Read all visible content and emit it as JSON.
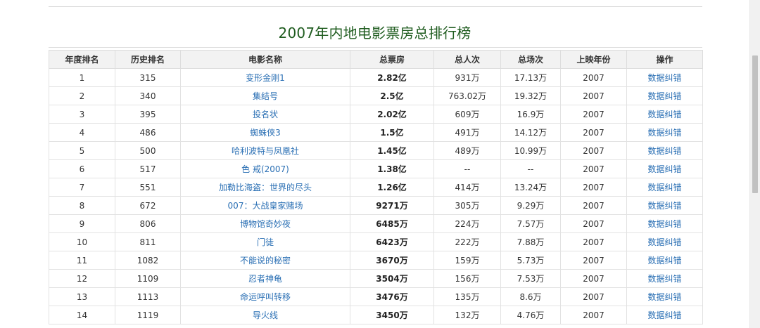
{
  "page": {
    "title": "2007年内地电影票房总排行榜"
  },
  "table": {
    "headers": [
      "年度排名",
      "历史排名",
      "电影名称",
      "总票房",
      "总人次",
      "总场次",
      "上映年份",
      "操作"
    ],
    "rows": [
      {
        "year_rank": "1",
        "hist_rank": "315",
        "title": "变形金刚1",
        "box": "2.82亿",
        "admissions": "931万",
        "screenings": "17.13万",
        "year": "2007",
        "action": "数据纠错"
      },
      {
        "year_rank": "2",
        "hist_rank": "340",
        "title": "集结号",
        "box": "2.5亿",
        "admissions": "763.02万",
        "screenings": "19.32万",
        "year": "2007",
        "action": "数据纠错"
      },
      {
        "year_rank": "3",
        "hist_rank": "395",
        "title": "投名状",
        "box": "2.02亿",
        "admissions": "609万",
        "screenings": "16.9万",
        "year": "2007",
        "action": "数据纠错"
      },
      {
        "year_rank": "4",
        "hist_rank": "486",
        "title": "蜘蛛侠3",
        "box": "1.5亿",
        "admissions": "491万",
        "screenings": "14.12万",
        "year": "2007",
        "action": "数据纠错"
      },
      {
        "year_rank": "5",
        "hist_rank": "500",
        "title": "哈利波特与凤凰社",
        "box": "1.45亿",
        "admissions": "489万",
        "screenings": "10.99万",
        "year": "2007",
        "action": "数据纠错"
      },
      {
        "year_rank": "6",
        "hist_rank": "517",
        "title": "色 戒(2007)",
        "box": "1.38亿",
        "admissions": "--",
        "screenings": "--",
        "year": "2007",
        "action": "数据纠错"
      },
      {
        "year_rank": "7",
        "hist_rank": "551",
        "title": "加勒比海盗：世界的尽头",
        "box": "1.26亿",
        "admissions": "414万",
        "screenings": "13.24万",
        "year": "2007",
        "action": "数据纠错"
      },
      {
        "year_rank": "8",
        "hist_rank": "672",
        "title": "007：大战皇家赌场",
        "box": "9271万",
        "admissions": "305万",
        "screenings": "9.29万",
        "year": "2007",
        "action": "数据纠错"
      },
      {
        "year_rank": "9",
        "hist_rank": "806",
        "title": "博物馆奇妙夜",
        "box": "6485万",
        "admissions": "224万",
        "screenings": "7.57万",
        "year": "2007",
        "action": "数据纠错"
      },
      {
        "year_rank": "10",
        "hist_rank": "811",
        "title": "门徒",
        "box": "6423万",
        "admissions": "222万",
        "screenings": "7.88万",
        "year": "2007",
        "action": "数据纠错"
      },
      {
        "year_rank": "11",
        "hist_rank": "1082",
        "title": "不能说的秘密",
        "box": "3670万",
        "admissions": "159万",
        "screenings": "5.73万",
        "year": "2007",
        "action": "数据纠错"
      },
      {
        "year_rank": "12",
        "hist_rank": "1109",
        "title": "忍者神龟",
        "box": "3504万",
        "admissions": "156万",
        "screenings": "7.53万",
        "year": "2007",
        "action": "数据纠错"
      },
      {
        "year_rank": "13",
        "hist_rank": "1113",
        "title": "命运呼叫转移",
        "box": "3476万",
        "admissions": "135万",
        "screenings": "8.6万",
        "year": "2007",
        "action": "数据纠错"
      },
      {
        "year_rank": "14",
        "hist_rank": "1119",
        "title": "导火线",
        "box": "3450万",
        "admissions": "132万",
        "screenings": "4.76万",
        "year": "2007",
        "action": "数据纠错"
      }
    ]
  },
  "colors": {
    "title": "#1f5c1f",
    "link": "#2a6fb4",
    "header_bg": "#f2f2f2"
  }
}
